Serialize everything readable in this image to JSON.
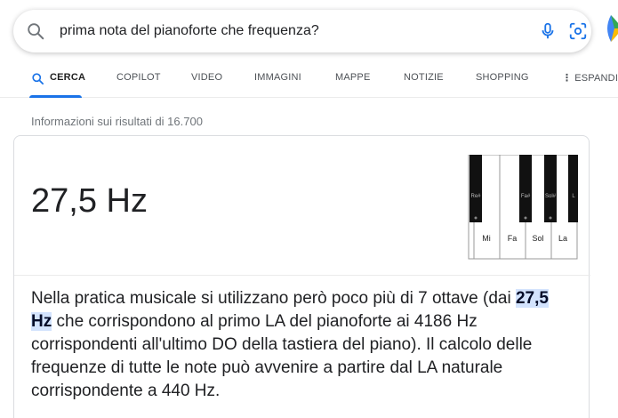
{
  "search": {
    "query": "prima nota del pianoforte che frequenza?",
    "icons": [
      "search-icon",
      "microphone-icon",
      "camera-lens-icon"
    ]
  },
  "tabs": [
    {
      "label": "CERCA",
      "active": true
    },
    {
      "label": "COPILOT",
      "active": false
    },
    {
      "label": "VIDEO",
      "active": false
    },
    {
      "label": "IMMAGINI",
      "active": false
    },
    {
      "label": "MAPPE",
      "active": false
    },
    {
      "label": "NOTIZIE",
      "active": false
    },
    {
      "label": "SHOPPING",
      "active": false
    },
    {
      "label": "ESPANDI",
      "active": false,
      "icon": "more-vert-icon"
    }
  ],
  "results_info": "Informazioni sui risultati di 16.700",
  "answer": {
    "value": "27,5 Hz",
    "image": {
      "black_key_labels": [
        "Re#",
        "Fa#",
        "Sol#",
        "L"
      ],
      "white_key_labels": [
        "Mi",
        "Fa",
        "Sol",
        "La"
      ]
    }
  },
  "snippet": {
    "before": "Nella pratica musicale si utilizzano però poco più di 7 ottave (dai ",
    "highlight": "27,5 Hz",
    "after": " che corrispondono al primo LA del pianoforte ai 4186 Hz corrispondenti all'ultimo DO della tastiera del piano). Il calcolo delle frequenze di tutte le note può avvenire a partire dal LA naturale corrispondente a 440 Hz."
  },
  "colors": {
    "accent": "#1a73e8",
    "highlight_bg": "#d3e3fd",
    "text": "#202124",
    "muted": "#70757a"
  }
}
